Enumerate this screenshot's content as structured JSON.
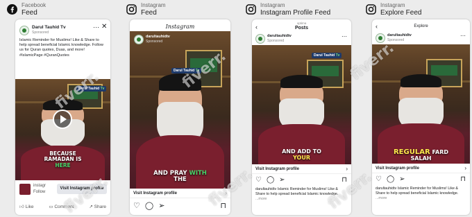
{
  "columns": [
    {
      "platform": "Facebook",
      "placement": "Feed"
    },
    {
      "platform": "Instagram",
      "placement": "Feed"
    },
    {
      "platform": "Instagram",
      "placement": "Instagram Profile Feed"
    },
    {
      "platform": "Instagram",
      "placement": "Explore Feed"
    }
  ],
  "fb_feed": {
    "page_name": "Darul Tauhid Tv",
    "sponsored": "Sponsored",
    "body_text": "Islamic Reminder for Muslims! Like & Share to help spread beneficial Islamic knowledge. Follow us for Quran quotes, Duas, and more! #IslamicPage #QuranQuotes",
    "logo_text": "Darul Tauhid",
    "logo_accent": "Tv",
    "caption_line1": "BECAUSE",
    "caption_line2": "RAMADAN IS",
    "caption_line3": "HERE",
    "cta_account": "instagr",
    "cta_sub": "Follow",
    "cta_button": "Visit Instagram profile",
    "actions": [
      "Like",
      "Comment",
      "Share"
    ]
  },
  "ig_feed": {
    "wordmark": "Instagram",
    "account": "darultauhidtv",
    "sponsored": "Sponsored",
    "logo_text": "Darul Tauhid",
    "logo_accent": "Tv",
    "caption_a": "AND PRAY",
    "caption_b": "WITH",
    "caption_c": "THE",
    "cta": "Visit Instagram profile"
  },
  "ig_profile": {
    "header_sub": "optima",
    "header_title": "Posts",
    "account": "darultauhidtv",
    "sponsored": "Sponsored",
    "logo_text": "Darul Tauhid",
    "logo_accent": "Tv",
    "caption_a": "AND ADD TO",
    "caption_b": "YOUR",
    "cta": "Visit Instagram profile",
    "body": "darultauhidtv Islamic Reminder for Muslims! Like & Share to help spread beneficial Islamic knowledge.",
    "more": "...more"
  },
  "ig_explore": {
    "header_title": "Explore",
    "account": "darultauhidtv",
    "sponsored": "Sponsored",
    "caption_a": "REGULAR",
    "caption_b": "FARD",
    "caption_c": "SALAH",
    "cta": "Visit Instagram profile",
    "body": "darultauhidtv Islamic Reminder for Muslims! Like & Share to help spread beneficial Islamic knowledge.",
    "more": "...more"
  },
  "watermark": "fiverr.",
  "colors": {
    "fb_blue": "#1877f2",
    "caption_green": "#4ad46a",
    "caption_yellow": "#ffe94d",
    "shirt": "#7a1f2e"
  }
}
